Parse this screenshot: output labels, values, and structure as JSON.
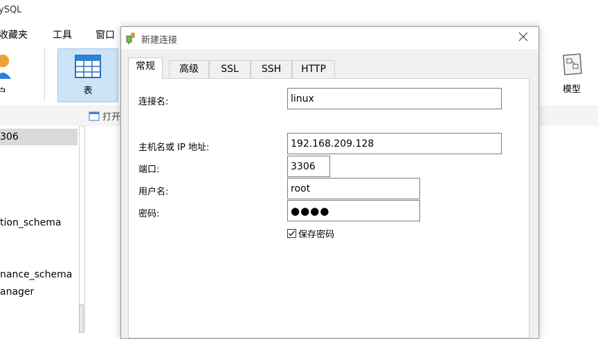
{
  "app": {
    "title": "ySQL",
    "menu": [
      "收藏夹",
      "工具",
      "窗口"
    ],
    "toolbar": {
      "user_label": "户",
      "table_label": "表",
      "model_label": "模型"
    },
    "subtoolbar": {
      "open_label": "打开"
    },
    "sidebar": {
      "items": [
        "306",
        "tion_schema",
        "nance_schema",
        "anager"
      ]
    }
  },
  "dialog": {
    "title": "新建连接",
    "tabs": [
      "常规",
      "高级",
      "SSL",
      "SSH",
      "HTTP"
    ],
    "active_tab": "常规",
    "fields": {
      "connection_name": {
        "label": "连接名:",
        "value": "linux"
      },
      "host": {
        "label": "主机名或 IP 地址:",
        "value": "192.168.209.128"
      },
      "port": {
        "label": "端口:",
        "value": "3306"
      },
      "username": {
        "label": "用户名:",
        "value": "root"
      },
      "password": {
        "label": "密码:",
        "value": "●●●●"
      }
    },
    "save_password": {
      "label": "保存密码",
      "checked": true
    }
  },
  "colors": {
    "accent": "#cce4f7",
    "accent_border": "#99c9ef",
    "panel_bg": "#f0f0f0"
  }
}
